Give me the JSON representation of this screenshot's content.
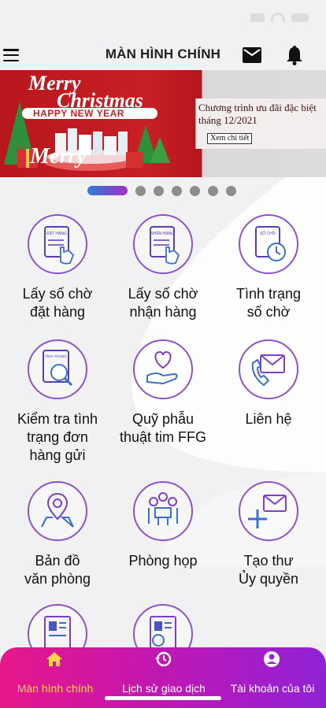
{
  "header": {
    "title": "MÀN HÌNH CHÍNH",
    "menu_icon": "hamburger-icon",
    "mail_icon": "mail-icon",
    "bell_icon": "bell-icon"
  },
  "banner": {
    "headline_line1": "Merry",
    "headline_line2": "Christmas",
    "headline_line3": "HAPPY NEW YEAR",
    "promo_text": "Chương trình ưu đãi đặc biệt tháng 12/2021",
    "promo_button": "Xem chi tiết",
    "colors": {
      "red": "#c81f26",
      "gray": "#dcdcdc"
    }
  },
  "carousel": {
    "total": 7,
    "active": 0
  },
  "menu": {
    "items": [
      {
        "label_line1": "Lấy số chờ",
        "label_line2": "đặt hàng",
        "label_line3": "",
        "icon": "order-ticket-icon",
        "icon_text": "ĐẶT HÀNG"
      },
      {
        "label_line1": "Lấy số chờ",
        "label_line2": "nhận hàng",
        "label_line3": "",
        "icon": "receive-ticket-icon",
        "icon_text": "NHẬN HÀNG"
      },
      {
        "label_line1": "Tình trạng",
        "label_line2": "số chờ",
        "label_line3": "",
        "icon": "queue-status-icon",
        "icon_text": "SỐ CHỜ"
      },
      {
        "label_line1": "Kiểm tra tình",
        "label_line2": "trạng đơn",
        "label_line3": "hàng gửi",
        "icon": "order-status-search-icon",
        "icon_text": "TÌNH TRẠNG"
      },
      {
        "label_line1": "Quỹ phẫu",
        "label_line2": "thuật tim FFG",
        "label_line3": "",
        "icon": "heart-hand-icon",
        "icon_text": ""
      },
      {
        "label_line1": "Liên hệ",
        "label_line2": "",
        "label_line3": "",
        "icon": "phone-mail-icon",
        "icon_text": ""
      },
      {
        "label_line1": "Bản đồ",
        "label_line2": "văn phòng",
        "label_line3": "",
        "icon": "map-pin-icon",
        "icon_text": ""
      },
      {
        "label_line1": "Phòng họp",
        "label_line2": "",
        "label_line3": "",
        "icon": "meeting-room-icon",
        "icon_text": ""
      },
      {
        "label_line1": "Tạo thư",
        "label_line2": "Ủy quyền",
        "label_line3": "",
        "icon": "letter-plus-icon",
        "icon_text": ""
      },
      {
        "label_line1": "",
        "label_line2": "",
        "label_line3": "",
        "icon": "document-icon",
        "icon_text": ""
      },
      {
        "label_line1": "",
        "label_line2": "",
        "label_line3": "",
        "icon": "document-search-icon",
        "icon_text": ""
      }
    ]
  },
  "tabbar": {
    "tabs": [
      {
        "label": "Màn hình chính",
        "icon": "home-icon",
        "active": true
      },
      {
        "label": "Lịch sử giao dịch",
        "icon": "history-icon",
        "active": false
      },
      {
        "label": "Tài khoản của tôi",
        "icon": "account-icon",
        "active": false
      }
    ],
    "colors": {
      "start": "#e8178a",
      "end": "#8f22d6",
      "active_text": "#ffd34d"
    }
  }
}
